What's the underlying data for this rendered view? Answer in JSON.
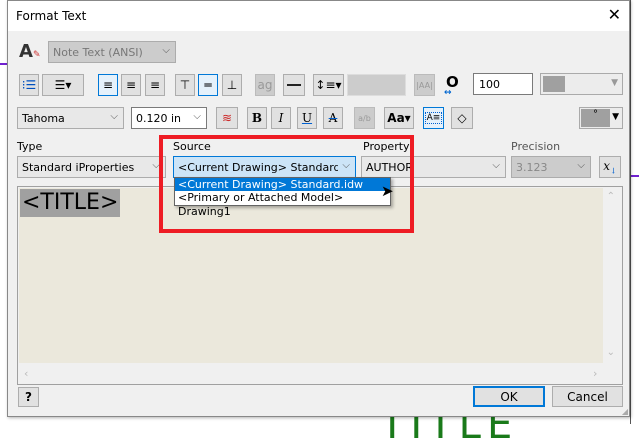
{
  "title": "Format Text",
  "style": {
    "value": "Note Text (ANSI)"
  },
  "toolbar1": {
    "spacing_value": "100"
  },
  "toolbar2": {
    "font": "Tahoma",
    "size": "0.120 in",
    "bold": "B",
    "italic": "I",
    "underline": "U",
    "strike": "A",
    "color_value": "°"
  },
  "fields": {
    "type_label": "Type",
    "type_value": "Standard iProperties",
    "source_label": "Source",
    "source_value": "<Current Drawing> Standard.idw",
    "property_label": "Property",
    "property_value": "AUTHOR",
    "precision_label": "Precision",
    "precision_value": "3.123"
  },
  "source_options": [
    "<Current Drawing> Standard.idw",
    "<Primary or Attached Model> Drawing1"
  ],
  "editor": {
    "text": "<TITLE>"
  },
  "footer": {
    "help": "?",
    "ok": "OK",
    "cancel": "Cancel"
  },
  "background": {
    "text": "TITLE"
  },
  "colors": {
    "highlight": "#ee1c24",
    "selection": "#0078d7"
  }
}
